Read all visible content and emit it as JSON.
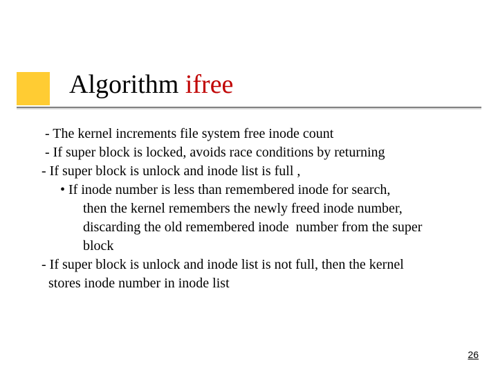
{
  "title": {
    "part1": "Algorithm ",
    "part2": "ifree"
  },
  "body": {
    "lines": [
      {
        "cls": "l0",
        "text": " - The kernel increments file system free inode count"
      },
      {
        "cls": "l0",
        "text": " - If super block is locked, avoids race conditions by returning"
      },
      {
        "cls": "l0",
        "text": "- If super block is unlock and inode list is full ,"
      },
      {
        "cls": "l1",
        "text": " • If inode number is less than remembered inode for search,"
      },
      {
        "cls": "l2",
        "text": "then the kernel remembers the newly freed inode number,"
      },
      {
        "cls": "l2",
        "text": "discarding the old remembered inode  number from the super"
      },
      {
        "cls": "l2",
        "text": "block"
      },
      {
        "cls": "l0",
        "text": "- If super block is unlock and inode list is not full, then the kernel"
      },
      {
        "cls": "l0",
        "text": "  stores inode number in inode list"
      }
    ]
  },
  "page_number": "26"
}
